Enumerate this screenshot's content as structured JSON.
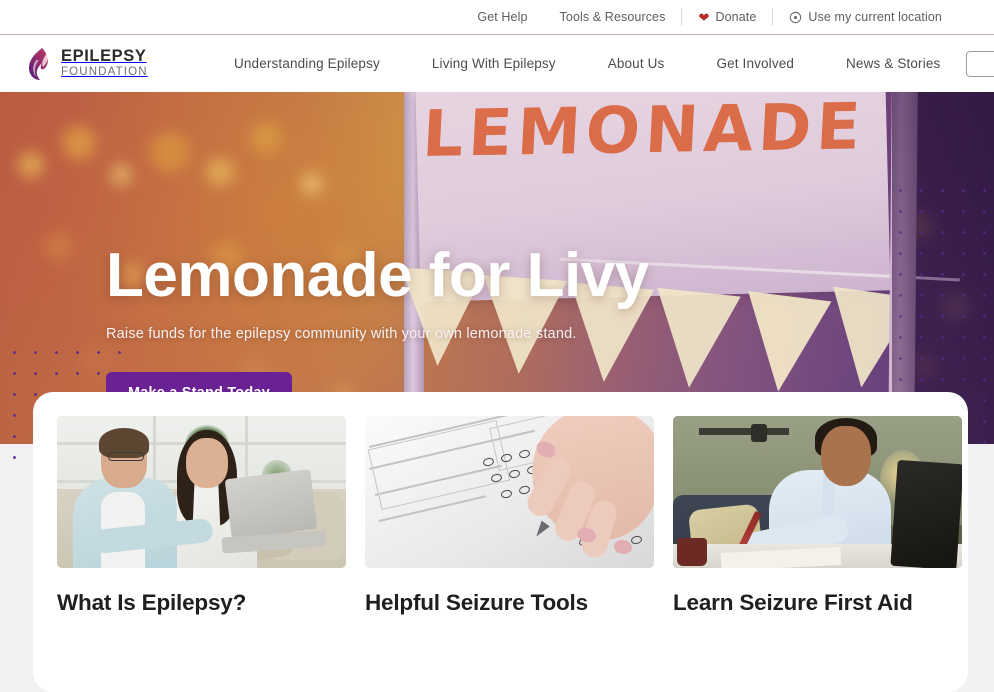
{
  "utility_bar": {
    "links": [
      {
        "label": "Get Help",
        "icon": null
      },
      {
        "label": "Tools & Resources",
        "icon": null
      },
      {
        "label": "Donate",
        "icon": "heart-icon"
      },
      {
        "label": "Use my current location",
        "icon": "location-pin-icon"
      }
    ]
  },
  "brand": {
    "name": "EPILEPSY",
    "sub": "FOUNDATION",
    "mark": "flame-icon"
  },
  "nav": {
    "items": [
      {
        "label": "Understanding Epilepsy"
      },
      {
        "label": "Living With Epilepsy"
      },
      {
        "label": "About Us"
      },
      {
        "label": "Get Involved"
      },
      {
        "label": "News & Stories"
      }
    ]
  },
  "search": {
    "value": "",
    "placeholder": "",
    "icon": "search-icon"
  },
  "hero": {
    "title": "Lemonade for Livy",
    "subtitle": "Raise funds for the epilepsy community with your own lemonade stand.",
    "cta_label": "Make a Stand Today",
    "cta_color": "#6a2193",
    "sign_text": "LEMONADE",
    "sign_text_color": "#d9572a",
    "image_alt": "Lemonade stand sign with bunting flags and warm bokeh lights"
  },
  "cards": [
    {
      "title": "What Is Epilepsy?",
      "image_alt": "Couple sitting on a couch looking at a laptop together"
    },
    {
      "title": "Helpful Seizure Tools",
      "image_alt": "Hand with a pen filling in bubbles on a printed questionnaire"
    },
    {
      "title": "Learn Seizure First Aid",
      "image_alt": "Woman at a desk writing with a pen while looking at a laptop"
    }
  ],
  "theme": {
    "accent_purple": "#6a2193",
    "donate_red": "#b32b22",
    "page_bg": "#f1f0f2",
    "dot_color": "#5b2b8a"
  }
}
